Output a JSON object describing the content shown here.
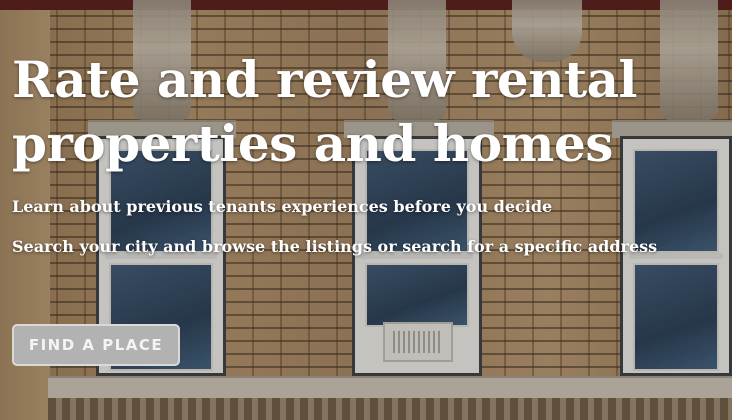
{
  "hero": {
    "headline": "Rate and review rental properties and homes",
    "tagline": "Learn about previous tenants experiences before you decide",
    "search_hint": "Search your city and browse the listings or search for a specific address",
    "cta_label": "FIND A PLACE"
  },
  "colors": {
    "text": "#ffffff",
    "button_bg": "#b2b2b2",
    "button_border": "#d9d9d9",
    "brick": "#a48563"
  }
}
